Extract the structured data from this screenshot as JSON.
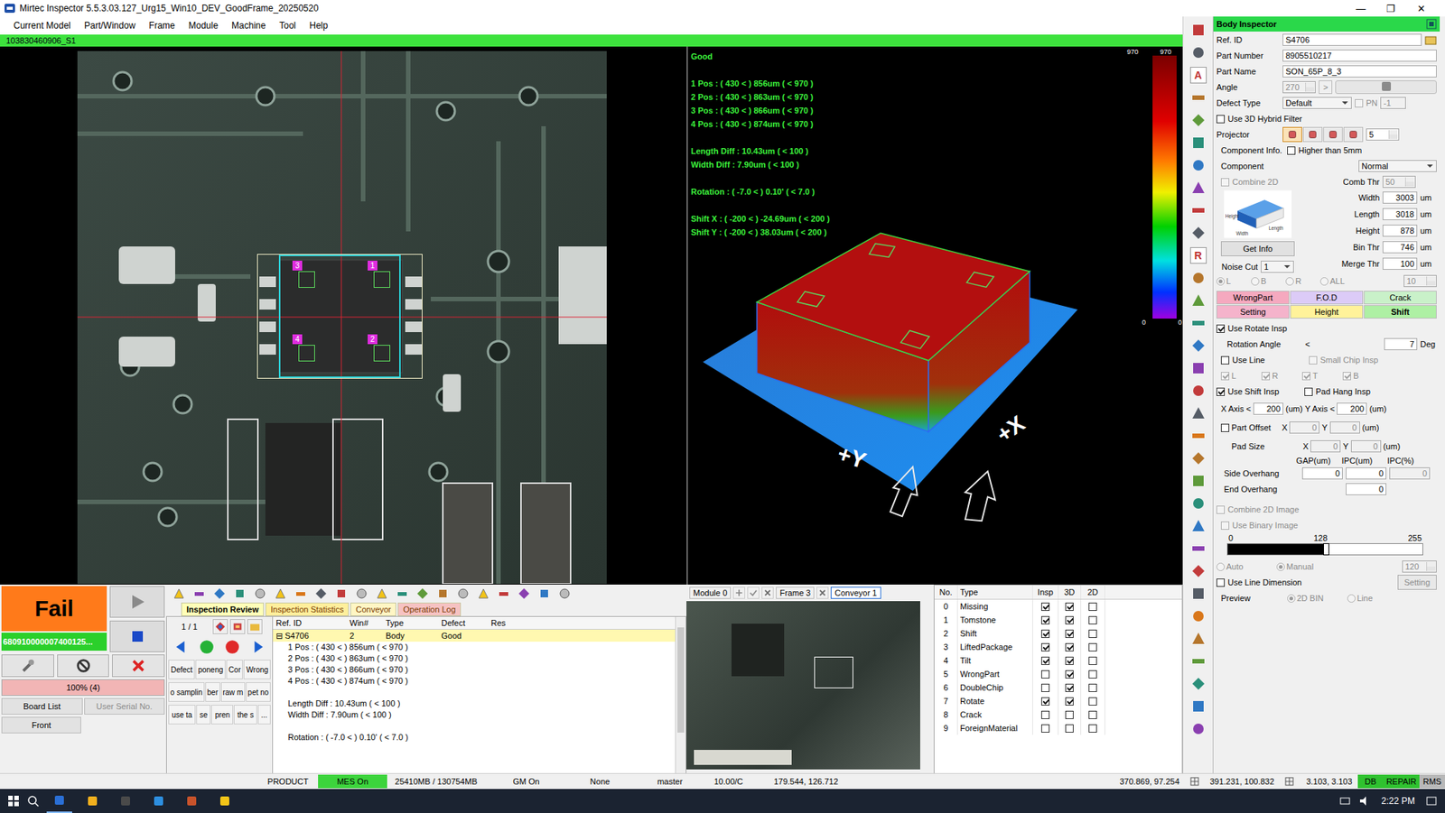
{
  "window": {
    "title": "Mirtec Inspector 5.5.3.03.127_Urg15_Win10_DEV_GoodFrame_20250520",
    "controls": [
      "—",
      "❐",
      "✕"
    ]
  },
  "menu": [
    "Current Model",
    "Part/Window",
    "Frame",
    "Module",
    "Machine",
    "Tool",
    "Help"
  ],
  "model_bar": "103830460906_S1",
  "image_view": {
    "windows": [
      {
        "label": "3"
      },
      {
        "label": "1"
      },
      {
        "label": "4"
      },
      {
        "label": "2"
      }
    ]
  },
  "view3d": {
    "result": "Good",
    "groups": [
      [
        "1 Pos : ( 430 < ) 856um ( < 970 )",
        "2 Pos : ( 430 < ) 863um ( < 970 )",
        "3 Pos : ( 430 < ) 866um ( < 970 )",
        "4 Pos : ( 430 < ) 874um ( < 970 )"
      ],
      [
        "Length Diff : 10.43um ( < 100 )",
        "Width Diff : 7.90um ( < 100 )"
      ],
      [
        "Rotation : ( -7.0 < ) 0.10' ( < 7.0 )"
      ],
      [
        "Shift X : ( -200 < ) -24.69um ( < 200 )",
        "Shift Y : ( -200 < ) 38.03um ( < 200 )"
      ]
    ],
    "scale": {
      "top_left": "970",
      "top_right": "970",
      "bottom_left": "0",
      "bottom_right": "0"
    },
    "axes": [
      "+Y",
      "+X"
    ]
  },
  "toolbar": {
    "glyphs": [
      "A",
      "R"
    ]
  },
  "body_inspector": {
    "title": "Body Inspector",
    "fields": [
      {
        "label": "Ref. ID",
        "value": "S4706"
      },
      {
        "label": "Part Number",
        "value": "8905510217"
      },
      {
        "label": "Part Name",
        "value": "SON_65P_8_3"
      }
    ],
    "angle": {
      "label": "Angle",
      "value": "270",
      "step": ">",
      "disabled": true,
      "level": 0.5
    },
    "defect_type": {
      "label": "Defect Type",
      "value": "Default",
      "pn_label": "PN",
      "pn_checked": false,
      "pn_value": "-1"
    },
    "hybrid": {
      "label": "Use 3D Hybrid Filter",
      "checked": false
    },
    "projector": {
      "label": "Projector",
      "buttons": [
        {
          "selected": true
        },
        {
          "selected": false
        },
        {
          "selected": false
        },
        {
          "selected": false
        }
      ],
      "value": "5"
    },
    "component_info": {
      "label": "Component Info.",
      "higher_label": "Higher than 5mm",
      "higher_checked": false,
      "component_label": "Component",
      "component_value": "Normal",
      "combine_label": "Combine 2D",
      "combine_checked": false,
      "comb_thr_label": "Comb Thr",
      "comb_thr": "50",
      "diagram_labels": [
        "Height",
        "Width",
        "Length"
      ]
    },
    "dims": [
      {
        "label": "Width",
        "value": "3003",
        "unit": "um"
      },
      {
        "label": "Length",
        "value": "3018",
        "unit": "um"
      },
      {
        "label": "Height",
        "value": "878",
        "unit": "um"
      },
      {
        "label": "Bin Thr",
        "value": "746",
        "unit": "um"
      },
      {
        "label": "Merge Thr",
        "value": "100",
        "unit": "um"
      }
    ],
    "get_info": "Get Info",
    "noise_cut": {
      "label": "Noise Cut",
      "value": "1"
    },
    "sides": {
      "options": [
        {
          "label": "L",
          "selected": true
        },
        {
          "label": "B",
          "selected": false
        },
        {
          "label": "R",
          "selected": false
        },
        {
          "label": "ALL",
          "selected": false
        }
      ],
      "value": "10",
      "disabled": true
    },
    "tabs": [
      {
        "label": "WrongPart",
        "color": "#f5a9bf",
        "selected": false
      },
      {
        "label": "F.O.D",
        "color": "#dccbf7",
        "selected": false
      },
      {
        "label": "Crack",
        "color": "#c9f1c9",
        "selected": false
      },
      {
        "label": "Setting",
        "color": "#f5b3cb",
        "selected": false
      },
      {
        "label": "Height",
        "color": "#fff29a",
        "selected": false
      },
      {
        "label": "Shift",
        "color": "#aef0a4",
        "selected": true
      }
    ],
    "rotate": {
      "label": "Use Rotate Insp",
      "checked": true,
      "angle_label": "Rotation Angle",
      "lt": "<",
      "value": "7",
      "unit": "Deg"
    },
    "line": {
      "label": "Use Line",
      "checked": false,
      "small_label": "Small Chip Insp",
      "small_checked": false,
      "sides": [
        {
          "label": "L",
          "checked": true
        },
        {
          "label": "R",
          "checked": true
        },
        {
          "label": "T",
          "checked": true
        },
        {
          "label": "B",
          "checked": true
        }
      ]
    },
    "shift": {
      "label": "Use Shift Insp",
      "checked": true,
      "pad_hang_label": "Pad Hang Insp",
      "pad_hang_checked": false,
      "x_label": "X Axis",
      "y_label": "Y Axis",
      "lt": "<",
      "x": "200",
      "y": "200",
      "unit": "(um)"
    },
    "part_offset": {
      "label": "Part Offset",
      "checked": false,
      "x_label": "X",
      "x": "0",
      "y_label": "Y",
      "y": "0",
      "unit": "(um)"
    },
    "pad_size": {
      "label": "Pad Size",
      "x_label": "X",
      "x": "0",
      "y_label": "Y",
      "y": "0",
      "unit": "(um)"
    },
    "overhang": {
      "headers": [
        "GAP(um)",
        "IPC(um)",
        "IPC(%)"
      ],
      "side_label": "Side Overhang",
      "side": [
        "0",
        "0",
        "0"
      ],
      "end_label": "End Overhang",
      "end": "0"
    },
    "combine_image": {
      "label": "Combine 2D Image",
      "checked": false,
      "binary_label": "Use Binary Image",
      "binary_checked": false,
      "ticks": [
        "0",
        "128",
        "255"
      ],
      "level": 0.5,
      "modes": [
        {
          "label": "Auto",
          "selected": false
        },
        {
          "label": "Manual",
          "selected": true
        }
      ],
      "value": "120"
    },
    "line_dimension": {
      "label": "Use Line Dimension",
      "checked": false,
      "button": "Setting"
    },
    "preview": {
      "label": "Preview",
      "options": [
        {
          "label": "2D BIN",
          "selected": true
        },
        {
          "label": "Line",
          "selected": false
        }
      ]
    }
  },
  "control": {
    "result": "Fail",
    "barcode": "680910000007400125...",
    "progress": {
      "label": "100% (4)",
      "level": 1
    },
    "buttons": [
      {
        "label": "Board List",
        "disabled": false
      },
      {
        "label": "User Serial No.",
        "disabled": true
      }
    ],
    "side": "Front"
  },
  "review": {
    "tabs": [
      {
        "label": "Inspection Review",
        "selected": true,
        "color": "#ffffb8"
      },
      {
        "label": "Inspection Statistics",
        "selected": false,
        "color": "#ffef9c"
      },
      {
        "label": "Conveyor",
        "selected": false,
        "color": "#fff6c4"
      },
      {
        "label": "Operation Log",
        "selected": false,
        "color": "#f6c2c2"
      }
    ],
    "page": "1 / 1",
    "shortcut_rows": [
      [
        "Defect",
        "poneng",
        "Cor",
        "Wrong"
      ],
      [
        "o samplin",
        "ber",
        "raw m",
        "pet no"
      ],
      [
        "use ta",
        "se",
        "pren",
        "the s",
        "..."
      ]
    ],
    "columns": [
      "Ref. ID",
      "Win#",
      "Type",
      "Defect",
      "Res"
    ],
    "rows": [
      {
        "expander": "⊟",
        "ref": "S4706",
        "win": "2",
        "type": "Body",
        "defect": "Good",
        "res": "",
        "selected": true
      }
    ],
    "details": [
      "1 Pos : ( 430 < ) 856um ( < 970 )",
      "2 Pos : ( 430 < ) 863um ( < 970 )",
      "3 Pos : ( 430 < ) 866um ( < 970 )",
      "4 Pos : ( 430 < ) 874um ( < 970 )",
      "",
      "Length Diff : 10.43um ( < 100 )",
      "Width Diff : 7.90um ( < 100 )",
      "",
      "Rotation : ( -7.0 < ) 0.10' ( < 7.0 )"
    ]
  },
  "module": {
    "tabs": [
      {
        "label": "Module 0",
        "selected": false
      },
      {
        "label": "Frame 3",
        "selected": false
      },
      {
        "label": "Conveyor 1",
        "selected": true
      }
    ]
  },
  "defect_types": {
    "columns": [
      "No.",
      "Type",
      "Insp",
      "3D",
      "2D"
    ],
    "rows": [
      {
        "no": "0",
        "type": "Missing",
        "insp": true,
        "d3": true,
        "d2": false
      },
      {
        "no": "1",
        "type": "Tomstone",
        "insp": true,
        "d3": true,
        "d2": false
      },
      {
        "no": "2",
        "type": "Shift",
        "insp": true,
        "d3": true,
        "d2": false
      },
      {
        "no": "3",
        "type": "LiftedPackage",
        "insp": true,
        "d3": true,
        "d2": false
      },
      {
        "no": "4",
        "type": "Tilt",
        "insp": true,
        "d3": true,
        "d2": false
      },
      {
        "no": "5",
        "type": "WrongPart",
        "insp": false,
        "d3": true,
        "d2": false
      },
      {
        "no": "6",
        "type": "DoubleChip",
        "insp": false,
        "d3": true,
        "d2": false
      },
      {
        "no": "7",
        "type": "Rotate",
        "insp": true,
        "d3": true,
        "d2": false
      },
      {
        "no": "8",
        "type": "Crack",
        "insp": false,
        "d3": false,
        "d2": false
      },
      {
        "no": "9",
        "type": "ForeignMaterial",
        "insp": false,
        "d3": false,
        "d2": false
      }
    ]
  },
  "status_bar": [
    {
      "kind": "text",
      "text": "PRODUCT",
      "color": "#f0f0f0"
    },
    {
      "kind": "text",
      "text": "MES On",
      "color": "#3cd43c"
    },
    {
      "kind": "text",
      "text": "25410MB / 130754MB",
      "color": "#f0f0f0"
    },
    {
      "kind": "text",
      "text": "GM On",
      "color": "#f0f0f0"
    },
    {
      "kind": "text",
      "text": "None",
      "color": "#f0f0f0"
    },
    {
      "kind": "text",
      "text": "master",
      "color": "#f0f0f0"
    },
    {
      "kind": "text",
      "text": "10.00/C",
      "color": "#f0f0f0"
    },
    {
      "kind": "text",
      "text": "179.544, 126.712",
      "color": "#f0f0f0"
    },
    {
      "kind": "spacer",
      "text": "",
      "color": "#f0f0f0"
    },
    {
      "kind": "text",
      "text": "370.869, 97.254",
      "color": "#f0f0f0"
    },
    {
      "kind": "icon",
      "text": "",
      "color": "#f0f0f0"
    },
    {
      "kind": "text",
      "text": "391.231, 100.832",
      "color": "#f0f0f0"
    },
    {
      "kind": "icon",
      "text": "",
      "color": "#f0f0f0"
    },
    {
      "kind": "text",
      "text": "3.103, 3.103",
      "color": "#f0f0f0"
    },
    {
      "kind": "text",
      "text": "DB",
      "color": "#2fc22f"
    },
    {
      "kind": "text",
      "text": "REPAIR",
      "color": "#2fc22f"
    },
    {
      "kind": "text",
      "text": "RMS",
      "color": "#b8b8b8"
    }
  ],
  "taskbar": {
    "time": "2:22 PM"
  }
}
